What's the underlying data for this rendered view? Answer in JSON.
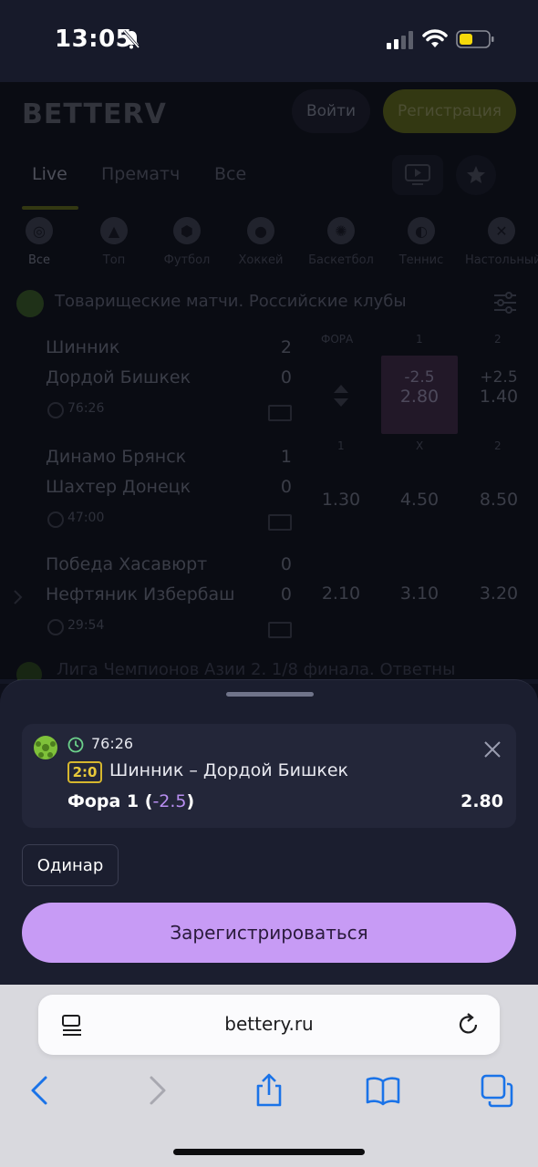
{
  "status_bar": {
    "time": "13:05"
  },
  "header": {
    "logo": "BETTERV",
    "login_label": "Войти",
    "register_label": "Регистрация"
  },
  "tabs": [
    {
      "label": "Live"
    },
    {
      "label": "Прематч"
    },
    {
      "label": "Все"
    }
  ],
  "sports": [
    {
      "label": "Все",
      "icon": "compass-icon"
    },
    {
      "label": "Топ",
      "icon": "fire-icon"
    },
    {
      "label": "Футбол",
      "icon": "soccer-ball-icon"
    },
    {
      "label": "Хоккей",
      "icon": "hockey-puck-icon"
    },
    {
      "label": "Баскетбол",
      "icon": "basketball-icon"
    },
    {
      "label": "Теннис",
      "icon": "tennis-ball-icon"
    },
    {
      "label": "Настольный",
      "icon": "table-tennis-icon"
    }
  ],
  "league": {
    "title": "Товарищеские матчи. Российские клубы"
  },
  "column_headers": {
    "block1": [
      "ФОРА",
      "1",
      "2"
    ],
    "block2": [
      "1",
      "X",
      "2"
    ]
  },
  "matches": [
    {
      "home": "Шинник",
      "away": "Дордой Бишкек",
      "home_score": "2",
      "away_score": "0",
      "time": "76:26",
      "odds": [
        {
          "line": "",
          "value": ""
        },
        {
          "line": "-2.5",
          "value": "2.80"
        },
        {
          "line": "+2.5",
          "value": "1.40"
        }
      ]
    },
    {
      "home": "Динамо Брянск",
      "away": "Шахтер Донецк",
      "home_score": "1",
      "away_score": "0",
      "time": "47:00",
      "odds": [
        {
          "value": "1.30"
        },
        {
          "value": "4.50"
        },
        {
          "value": "8.50"
        }
      ]
    },
    {
      "home": "Победа Хасавюрт",
      "away": "Нефтяник Избербаш",
      "home_score": "0",
      "away_score": "0",
      "time": "29:54",
      "odds": [
        {
          "value": "2.10"
        },
        {
          "value": "3.10"
        },
        {
          "value": "3.20"
        }
      ]
    }
  ],
  "league2": {
    "title": "Лига Чемпионов Азии 2. 1/8 финала. Ответны"
  },
  "bet_slip": {
    "time": "76:26",
    "score": "2:0",
    "match": "Шинник – Дордой Бишкек",
    "market_prefix": "Фора 1 (",
    "market_value": "-2.5",
    "market_suffix": ")",
    "odd": "2.80",
    "type_label": "Одинар",
    "register_button": "Зарегистрироваться"
  },
  "browser": {
    "url": "bettery.ru"
  },
  "colors": {
    "accent_purple": "#c79bf5",
    "score_badge": "#e8c93a",
    "sheet_bg": "#1b1e2f"
  }
}
